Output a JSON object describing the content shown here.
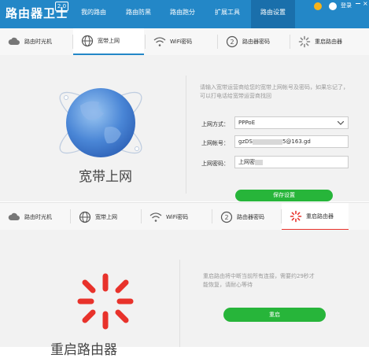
{
  "header": {
    "app_title": "路由器卫士",
    "version": "2.0",
    "tabs": [
      {
        "label": "我的路由"
      },
      {
        "label": "路由防黑"
      },
      {
        "label": "路由跑分"
      },
      {
        "label": "扩展工具"
      },
      {
        "label": "路由设置"
      }
    ],
    "active_tab": 4,
    "login_label": "登录",
    "brand_color": "#2387c7"
  },
  "subtabs_a": [
    {
      "label": "路由时光机",
      "icon": "cloud-icon"
    },
    {
      "label": "宽带上网",
      "icon": "globe-icon"
    },
    {
      "label": "WiFi密码",
      "icon": "wifi-icon"
    },
    {
      "label": "路由器密码",
      "icon": "lock-icon"
    },
    {
      "label": "重启路由器",
      "icon": "restart-icon"
    }
  ],
  "broadband": {
    "title": "宽带上网",
    "hint_line1": "请输入宽带运营商给您的宽带上网帐号及密码，如果忘记了，",
    "hint_line2": "可以打电话给宽带运营商找回",
    "mode_label": "上网方式：",
    "mode_value": "PPPoE",
    "account_label": "上网帐号：",
    "account_prefix": "gzDS",
    "account_suffix": "5@163.gd",
    "password_label": "上网密码：",
    "password_value": "上网密",
    "save_label": "保存设置"
  },
  "subtabs_b": [
    {
      "label": "路由时光机",
      "icon": "cloud-icon"
    },
    {
      "label": "宽带上网",
      "icon": "globe-icon"
    },
    {
      "label": "WiFi密码",
      "icon": "wifi-icon"
    },
    {
      "label": "路由器密码",
      "icon": "lock-icon"
    },
    {
      "label": "重启路由器",
      "icon": "restart-icon"
    }
  ],
  "restart": {
    "title": "重启路由器",
    "hint_line1": "重启路由将中断当前所有连接，需要约29秒才",
    "hint_line2": "能恢复，请耐心等待",
    "button_label": "重启",
    "accent_color": "#e8322b"
  }
}
